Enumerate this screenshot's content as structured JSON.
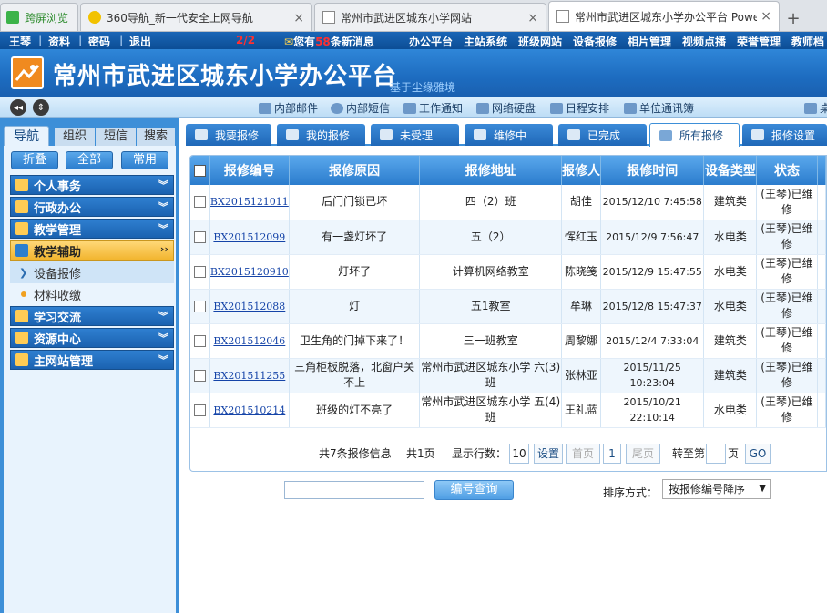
{
  "browser": {
    "tabs": [
      {
        "label": "跨屏浏览",
        "active": false
      },
      {
        "label": "360导航_新一代安全上网导航",
        "active": false
      },
      {
        "label": "常州市武进区城东小学网站",
        "active": false
      },
      {
        "label": "常州市武进区城东小学办公平台 Powe",
        "active": true
      }
    ],
    "new_tab": "+",
    "close": "×"
  },
  "topbar": {
    "user": "王琴",
    "profile": "资料",
    "password": "密码",
    "logout": "退出",
    "pager": "2/2",
    "msg_prefix": "您有",
    "msg_count": "58",
    "msg_suffix": "条新消息",
    "links": [
      "办公平台",
      "主站系统",
      "班级网站",
      "设备报修",
      "相片管理",
      "视频点播",
      "荣誉管理",
      "教师档"
    ]
  },
  "banner": {
    "title": "常州市武进区城东小学办公平台",
    "subtitle": "基于尘缘雅境"
  },
  "toolbar": {
    "items": [
      "内部邮件",
      "内部短信",
      "工作通知",
      "网络硬盘",
      "日程安排",
      "单位通讯簿"
    ],
    "right_stub": "桌"
  },
  "nav": {
    "tabs": [
      "导航",
      "组织",
      "短信",
      "搜索"
    ],
    "buttons": [
      "折叠",
      "全部",
      "常用"
    ],
    "menus": [
      "个人事务",
      "行政办公",
      "教学管理",
      "教学辅助",
      "学习交流",
      "资源中心",
      "主网站管理"
    ],
    "active_menu_index": 3,
    "submenus": [
      "设备报修",
      "材料收缴"
    ]
  },
  "content_tabs": [
    "我要报修",
    "我的报修",
    "未受理",
    "维修中",
    "已完成",
    "所有报修",
    "报修设置"
  ],
  "active_content_tab": 5,
  "grid": {
    "headers": [
      "报修编号",
      "报修原因",
      "报修地址",
      "报修人",
      "报修时间",
      "设备类型",
      "状态"
    ],
    "rows": [
      {
        "code": "BX2015121011",
        "reason": "后门门锁已坏",
        "address": "四（2）班",
        "person": "胡佳",
        "time": "2015/12/10 7:45:58",
        "type": "建筑类",
        "status": "(王琴)已维修"
      },
      {
        "code": "BX201512099",
        "reason": "有一盏灯坏了",
        "address": "五（2）",
        "person": "恽红玉",
        "time": "2015/12/9 7:56:47",
        "type": "水电类",
        "status": "(王琴)已维修"
      },
      {
        "code": "BX2015120910",
        "reason": "灯坏了",
        "address": "计算机网络教室",
        "person": "陈晓笺",
        "time": "2015/12/9 15:47:55",
        "type": "水电类",
        "status": "(王琴)已维修"
      },
      {
        "code": "BX201512088",
        "reason": "灯",
        "address": "五1教室",
        "person": "牟琳",
        "time": "2015/12/8 15:47:37",
        "type": "水电类",
        "status": "(王琴)已维修"
      },
      {
        "code": "BX201512046",
        "reason": "卫生角的门掉下来了！",
        "address": "三一班教室",
        "person": "周黎娜",
        "time": "2015/12/4 7:33:04",
        "type": "建筑类",
        "status": "(王琴)已维修"
      },
      {
        "code": "BX201511255",
        "reason": "三角柜板脱落，北窗户关不上",
        "address": "常州市武进区城东小学 六(3)班",
        "person": "张林亚",
        "time": "2015/11/25 10:23:04",
        "type": "建筑类",
        "status": "(王琴)已维修"
      },
      {
        "code": "BX201510214",
        "reason": "班级的灯不亮了",
        "address": "常州市武进区城东小学 五(4)班",
        "person": "王礼蓝",
        "time": "2015/10/21 22:10:14",
        "type": "水电类",
        "status": "(王琴)已维修"
      }
    ]
  },
  "pager": {
    "total": "共7条报修信息",
    "pages": "共1页",
    "rows_label": "显示行数：",
    "rows_value": "10",
    "set": "设置",
    "first": "首页",
    "current": "1",
    "last": "尾页",
    "goto_prefix": "转至第",
    "goto_suffix": "页",
    "go": "GO"
  },
  "search": {
    "placeholder": "",
    "button": "编号查询",
    "sort_label": "排序方式：",
    "sort_value": "按报修编号降序"
  }
}
